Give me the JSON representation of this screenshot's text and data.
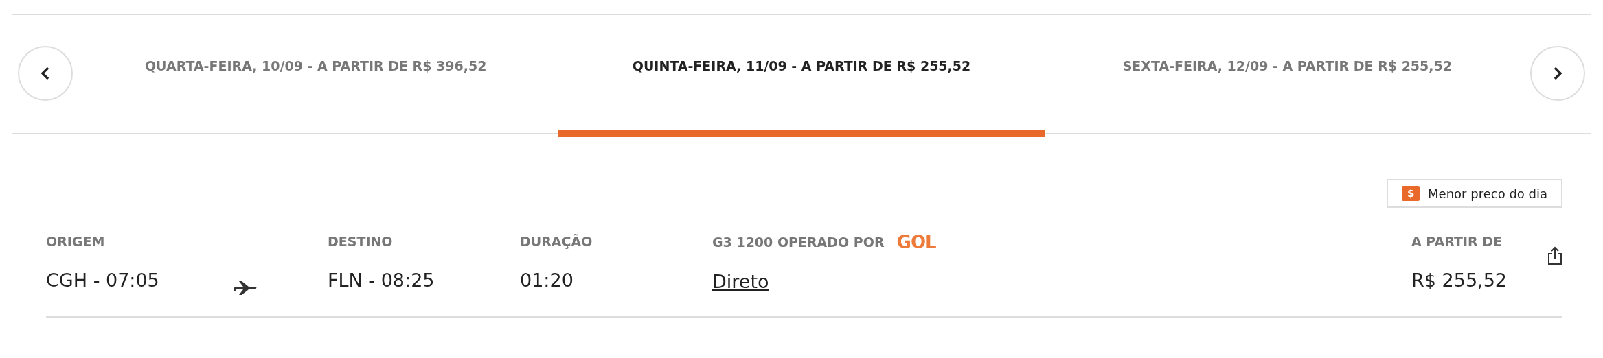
{
  "date_tabs": [
    {
      "label": "QUARTA-FEIRA, 10/09 - A PARTIR DE R$ 396,52",
      "selected": false
    },
    {
      "label": "QUINTA-FEIRA, 11/09 - A PARTIR DE R$ 255,52",
      "selected": true
    },
    {
      "label": "SEXTA-FEIRA, 12/09 - A PARTIR DE R$ 255,52",
      "selected": false
    }
  ],
  "badge": {
    "icon": "$",
    "label": "Menor preco do dia"
  },
  "flight": {
    "origin_label": "ORIGEM",
    "origin": "CGH - 07:05",
    "destination_label": "DESTINO",
    "destination": "FLN - 08:25",
    "duration_label": "DURAÇÃO",
    "duration": "01:20",
    "operator_label": "G3 1200 OPERADO POR",
    "airline_logo": "GOL",
    "stops": "Direto",
    "price_label": "A PARTIR DE",
    "price": "R$ 255,52"
  }
}
